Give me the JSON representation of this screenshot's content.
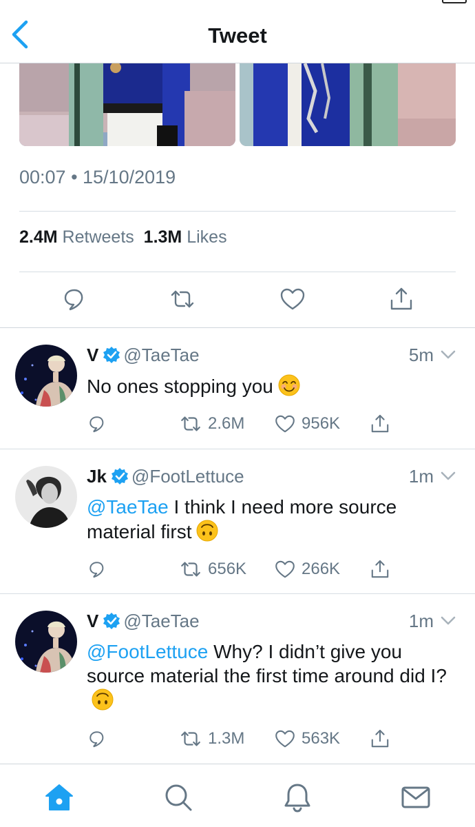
{
  "header": {
    "title": "Tweet"
  },
  "tweet": {
    "timestamp": "00:07 • 15/10/2019",
    "retweets_count": "2.4M",
    "retweets_label": "Retweets",
    "likes_count": "1.3M",
    "likes_label": "Likes"
  },
  "replies": [
    {
      "name": "V",
      "handle": "@TaeTae",
      "time": "5m",
      "mention": "",
      "text": "No ones stopping you",
      "emoji": "smiling-face-emoji",
      "retweets": "2.6M",
      "likes": "956K"
    },
    {
      "name": "Jk",
      "handle": "@FootLettuce",
      "time": "1m",
      "mention": "@TaeTae",
      "text": " I think I need more source material first",
      "emoji": "upside-down-face-emoji",
      "retweets": "656K",
      "likes": "266K"
    },
    {
      "name": "V",
      "handle": "@TaeTae",
      "time": "1m",
      "mention": "@FootLettuce",
      "text": " Why? I didn’t give you source material the first time around did I?",
      "emoji": "upside-down-face-emoji",
      "retweets": "1.3M",
      "likes": "563K"
    }
  ],
  "colors": {
    "accent": "#1da1f2",
    "secondary_text": "#657786",
    "divider": "#cfd6dc"
  },
  "icons": {
    "back": "chevron-left-icon",
    "reply": "reply-icon",
    "retweet": "retweet-icon",
    "like": "heart-icon",
    "share": "share-icon",
    "verified": "verified-badge-icon",
    "tabs": [
      "home-icon",
      "search-icon",
      "notifications-icon",
      "messages-icon"
    ]
  }
}
